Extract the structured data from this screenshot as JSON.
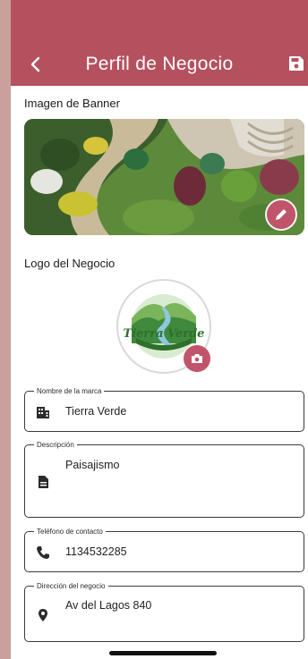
{
  "header": {
    "title": "Perfil de Negocio",
    "back_icon": "chevron-left-icon",
    "save_icon": "floppy-disk-icon",
    "color": "#b5505f"
  },
  "banner": {
    "label": "Imagen de Banner",
    "edit_icon": "pencil-icon"
  },
  "logo": {
    "label": "Logo del Negocio",
    "brand_text": "Tierra Verde",
    "camera_icon": "camera-icon"
  },
  "fields": {
    "brand": {
      "label": "Nombre de la marca",
      "value": "Tierra Verde",
      "icon": "building-icon"
    },
    "description": {
      "label": "Descripción",
      "value": "Paisajismo",
      "icon": "document-icon"
    },
    "phone": {
      "label": "Teléfono de contacto",
      "value": "1134532285",
      "icon": "phone-icon"
    },
    "address": {
      "label": "Dirección del negocio",
      "value": "Av del Lagos 840",
      "icon": "location-pin-icon"
    }
  },
  "accent_color": "#c0546a"
}
